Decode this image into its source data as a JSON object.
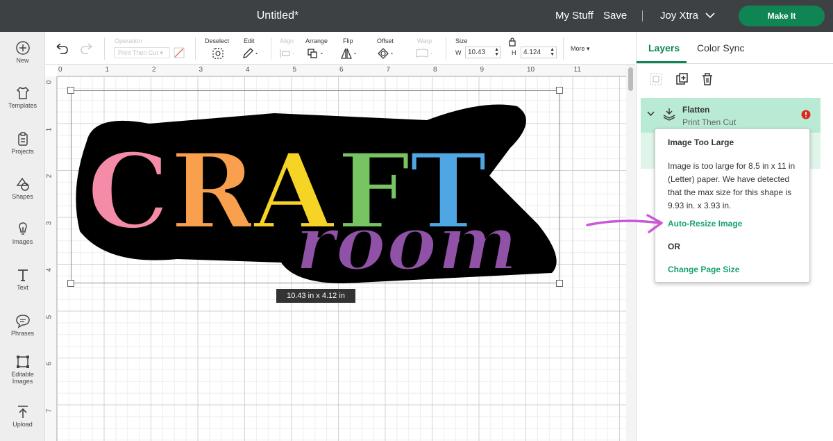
{
  "topbar": {
    "title": "Untitled*",
    "my_stuff": "My Stuff",
    "save": "Save",
    "account": "Joy Xtra",
    "make_it": "Make It",
    "accent": "#0f8553"
  },
  "sidebar": {
    "items": [
      {
        "label": "New",
        "icon": "plus-circle-icon"
      },
      {
        "label": "Templates",
        "icon": "shirt-icon"
      },
      {
        "label": "Projects",
        "icon": "clipboard-icon"
      },
      {
        "label": "Shapes",
        "icon": "shapes-icon"
      },
      {
        "label": "Images",
        "icon": "lightbulb-icon"
      },
      {
        "label": "Text",
        "icon": "text-t-icon"
      },
      {
        "label": "Phrases",
        "icon": "speech-bubble-icon"
      },
      {
        "label": "Editable",
        "label2": "Images",
        "icon": "editable-image-icon"
      },
      {
        "label": "Upload",
        "icon": "upload-icon"
      }
    ]
  },
  "toolbar": {
    "operation_label": "Operation",
    "operation_value": "Print Then Cut",
    "deselect": "Deselect",
    "edit": "Edit",
    "align": "Align",
    "arrange": "Arrange",
    "flip": "Flip",
    "offset": "Offset",
    "warp": "Warp",
    "size": "Size",
    "w_label": "W",
    "w_value": "10.43",
    "h_label": "H",
    "h_value": "4.124",
    "more": "More"
  },
  "ruler": {
    "h": [
      "0",
      "1",
      "2",
      "3",
      "4",
      "5",
      "6",
      "7",
      "8",
      "9",
      "10",
      "11"
    ],
    "v": [
      "0",
      "1",
      "2",
      "3",
      "4",
      "5",
      "6",
      "7"
    ]
  },
  "canvas": {
    "word1": "CRAFT",
    "word2": "room",
    "word1_colors": [
      "#f48ba7",
      "#f8a04d",
      "#f5d426",
      "#77c462",
      "#4ea7e2"
    ],
    "word2_color": "#8f52a6",
    "size_tip": "10.43  in x 4.12  in"
  },
  "panel": {
    "tabs": [
      "Layers",
      "Color Sync"
    ],
    "layer": {
      "name": "Flatten",
      "operation": "Print Then Cut"
    }
  },
  "popup": {
    "title": "Image Too Large",
    "body": "Image is too large for 8.5 in x 11 in (Letter) paper. We have detected that the max size for this shape is 9.93 in. x 3.93 in.",
    "resize": "Auto-Resize Image",
    "or": "OR",
    "change_size": "Change Page Size",
    "link_color": "#13a26b",
    "error_color": "#d62a1e"
  },
  "annotation": {
    "arrow_color": "#c95ad6"
  }
}
